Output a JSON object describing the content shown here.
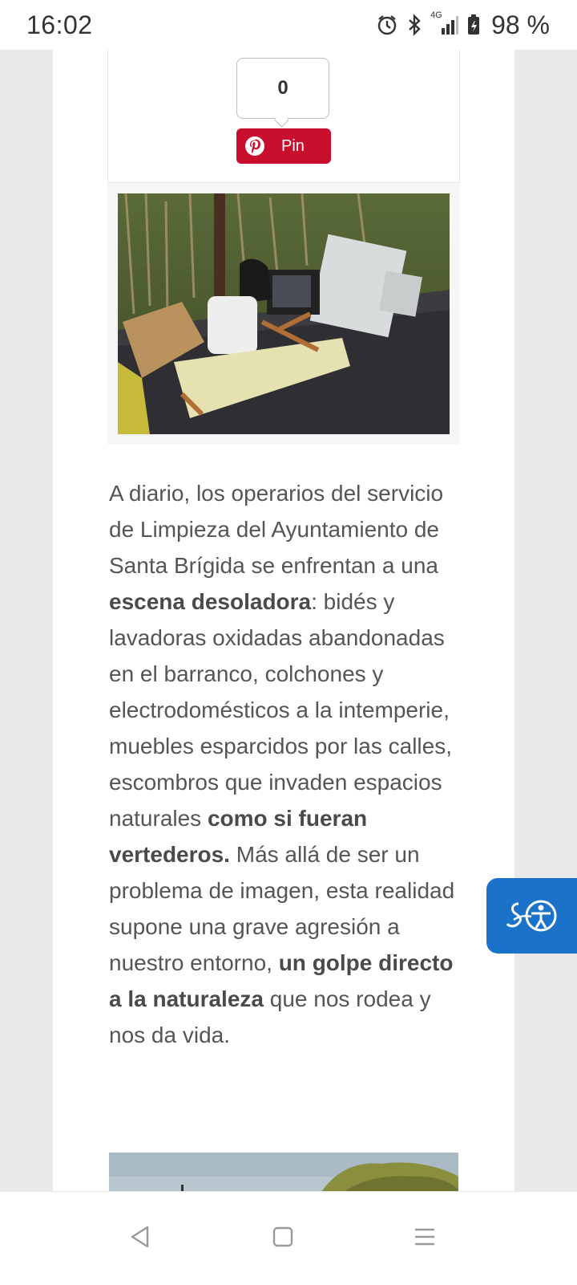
{
  "status_bar": {
    "time": "16:02",
    "network": "4G",
    "battery": "98 %",
    "icons": [
      "alarm-icon",
      "bluetooth-icon",
      "signal-icon",
      "battery-icon"
    ]
  },
  "share": {
    "pin_count": "0",
    "pin_label": "Pin",
    "pin_color": "#c8102e"
  },
  "article": {
    "paragraph_parts": [
      {
        "text": "A diario, los operarios del servicio de Limpieza del Ayuntamiento de Santa Brígida se enfrentan a una ",
        "bold": false
      },
      {
        "text": "escena desoladora",
        "bold": true
      },
      {
        "text": ": bidés y lavadoras oxidadas abandonadas en el barranco, colchones y electrodomésticos a la intemperie, muebles esparcidos por las calles, escombros que invaden espacios naturales ",
        "bold": false
      },
      {
        "text": "como si fueran vertederos.",
        "bold": true
      },
      {
        "text": " Más allá de ser un problema de imagen, esta realidad supone una grave agresión a nuestro entorno, ",
        "bold": false
      },
      {
        "text": "un golpe directo a la naturaleza",
        "bold": true
      },
      {
        "text": " que nos rodea y nos da vida.",
        "bold": false
      }
    ]
  },
  "accessibility": {
    "icon": "accessibility-icon",
    "color": "#1a73c8"
  },
  "nav_bar": {
    "icons": [
      "back-icon",
      "home-icon",
      "recents-icon"
    ]
  }
}
